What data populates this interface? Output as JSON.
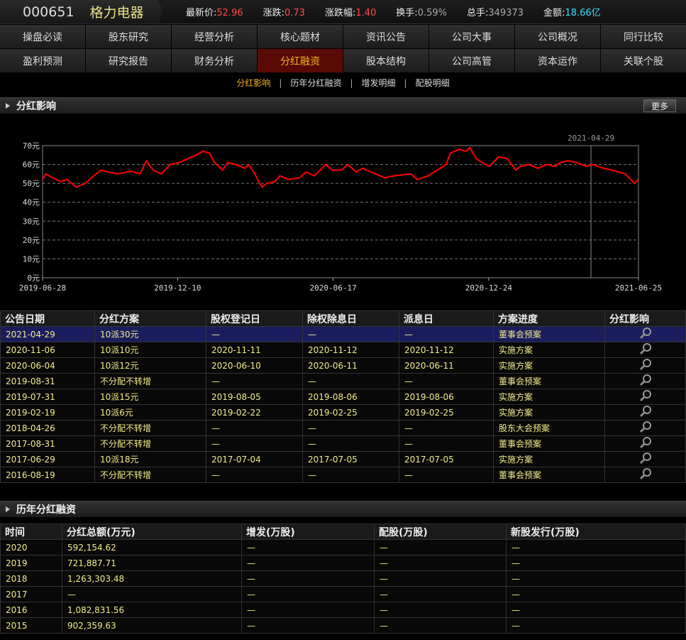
{
  "header": {
    "code": "000651",
    "name": "格力电器",
    "quote": [
      {
        "label": "最新价:",
        "value": "52.96",
        "color": "#ff4d4d"
      },
      {
        "label": "涨跌:",
        "value": "0.73",
        "color": "#ff4d4d"
      },
      {
        "label": "涨跌幅:",
        "value": "1.40",
        "color": "#ff4d4d"
      },
      {
        "label": "换手:",
        "value": "0.59%",
        "color": "#aaaaaa"
      },
      {
        "label": "总手:",
        "value": "349373",
        "color": "#aaaaaa"
      },
      {
        "label": "金额:",
        "value": "18.66亿",
        "color": "#33e0ff"
      }
    ]
  },
  "nav": {
    "row1": [
      "操盘必读",
      "股东研究",
      "经营分析",
      "核心题材",
      "资讯公告",
      "公司大事",
      "公司概况",
      "同行比较"
    ],
    "row2": [
      "盈利预测",
      "研究报告",
      "财务分析",
      "分红融资",
      "股本结构",
      "公司高管",
      "资本运作",
      "关联个股"
    ],
    "active": "分红融资"
  },
  "subnav": {
    "items": [
      "分红影响",
      "历年分红融资",
      "增发明细",
      "配股明细"
    ],
    "active": 0,
    "sep": "|"
  },
  "section1": {
    "title": "分红影响",
    "more": "更多"
  },
  "chart_data": {
    "type": "line",
    "ylim": [
      0,
      70
    ],
    "y_ticks": [
      "0元",
      "10元",
      "20元",
      "30元",
      "40元",
      "50元",
      "60元",
      "70元"
    ],
    "x_ticks": [
      {
        "day": 0,
        "label": "2019-06-28"
      },
      {
        "day": 165,
        "label": "2019-12-10"
      },
      {
        "day": 355,
        "label": "2020-06-17"
      },
      {
        "day": 545,
        "label": "2020-12-24"
      },
      {
        "day": 728,
        "label": "2021-06-25"
      }
    ],
    "marker": {
      "day": 670,
      "label": "2021-04-29"
    },
    "x_span_days": 728,
    "grid": true,
    "series": [
      {
        "name": "price",
        "color": "#ff0000",
        "points": [
          [
            0,
            52
          ],
          [
            4,
            55
          ],
          [
            12,
            53
          ],
          [
            22,
            51
          ],
          [
            30,
            52
          ],
          [
            41,
            48
          ],
          [
            52,
            50
          ],
          [
            60,
            53
          ],
          [
            71,
            57
          ],
          [
            81,
            56
          ],
          [
            92,
            55
          ],
          [
            108,
            56.5
          ],
          [
            119,
            55
          ],
          [
            127,
            62
          ],
          [
            135,
            57
          ],
          [
            145,
            55
          ],
          [
            156,
            60
          ],
          [
            167,
            61
          ],
          [
            177,
            63
          ],
          [
            188,
            65
          ],
          [
            196,
            67
          ],
          [
            204,
            66
          ],
          [
            210,
            61
          ],
          [
            220,
            57
          ],
          [
            226,
            61
          ],
          [
            236,
            60
          ],
          [
            247,
            58
          ],
          [
            252,
            60
          ],
          [
            258,
            56
          ],
          [
            268,
            48
          ],
          [
            274,
            50
          ],
          [
            284,
            51
          ],
          [
            290,
            54
          ],
          [
            300,
            52
          ],
          [
            314,
            53
          ],
          [
            322,
            56
          ],
          [
            332,
            54
          ],
          [
            346,
            60
          ],
          [
            354,
            57
          ],
          [
            365,
            57
          ],
          [
            373,
            60
          ],
          [
            383,
            56
          ],
          [
            391,
            58
          ],
          [
            407,
            55
          ],
          [
            418,
            53
          ],
          [
            429,
            54
          ],
          [
            450,
            55
          ],
          [
            458,
            52
          ],
          [
            471,
            54
          ],
          [
            482,
            57
          ],
          [
            493,
            60
          ],
          [
            498,
            66
          ],
          [
            509,
            68
          ],
          [
            517,
            67
          ],
          [
            522,
            69
          ],
          [
            530,
            63
          ],
          [
            541,
            60
          ],
          [
            546,
            59
          ],
          [
            557,
            64
          ],
          [
            568,
            63
          ],
          [
            578,
            57
          ],
          [
            584,
            59
          ],
          [
            594,
            60
          ],
          [
            605,
            58
          ],
          [
            616,
            60
          ],
          [
            626,
            59
          ],
          [
            632,
            61
          ],
          [
            642,
            62
          ],
          [
            653,
            61
          ],
          [
            664,
            59
          ],
          [
            672,
            60
          ],
          [
            685,
            58
          ],
          [
            696,
            57
          ],
          [
            712,
            55
          ],
          [
            723,
            50
          ],
          [
            728,
            52
          ]
        ]
      }
    ]
  },
  "table1": {
    "headers": [
      "公告日期",
      "分红方案",
      "股权登记日",
      "除权除息日",
      "派息日",
      "方案进度",
      "分红影响"
    ],
    "rows": [
      [
        "2021-04-29",
        "10派30元",
        "—",
        "—",
        "—",
        "董事会预案"
      ],
      [
        "2020-11-06",
        "10派10元",
        "2020-11-11",
        "2020-11-12",
        "2020-11-12",
        "实施方案"
      ],
      [
        "2020-06-04",
        "10派12元",
        "2020-06-10",
        "2020-06-11",
        "2020-06-11",
        "实施方案"
      ],
      [
        "2019-08-31",
        "不分配不转增",
        "—",
        "—",
        "—",
        "董事会预案"
      ],
      [
        "2019-07-31",
        "10派15元",
        "2019-08-05",
        "2019-08-06",
        "2019-08-06",
        "实施方案"
      ],
      [
        "2019-02-19",
        "10派6元",
        "2019-02-22",
        "2019-02-25",
        "2019-02-25",
        "实施方案"
      ],
      [
        "2018-04-26",
        "不分配不转增",
        "—",
        "—",
        "—",
        "股东大会预案"
      ],
      [
        "2017-08-31",
        "不分配不转增",
        "—",
        "—",
        "—",
        "董事会预案"
      ],
      [
        "2017-06-29",
        "10派18元",
        "2017-07-04",
        "2017-07-05",
        "2017-07-05",
        "实施方案"
      ],
      [
        "2016-08-19",
        "不分配不转增",
        "—",
        "—",
        "—",
        "董事会预案"
      ]
    ]
  },
  "section2": {
    "title": "历年分红融资"
  },
  "table2": {
    "headers": [
      "时间",
      "分红总额(万元)",
      "增发(万股)",
      "配股(万股)",
      "新股发行(万股)"
    ],
    "rows": [
      [
        "2020",
        "592,154.62",
        "—",
        "—",
        "—"
      ],
      [
        "2019",
        "721,887.71",
        "—",
        "—",
        "—"
      ],
      [
        "2018",
        "1,263,303.48",
        "—",
        "—",
        "—"
      ],
      [
        "2017",
        "—",
        "—",
        "—",
        "—"
      ],
      [
        "2016",
        "1,082,831.56",
        "—",
        "—",
        "—"
      ],
      [
        "2015",
        "902,359.63",
        "—",
        "—",
        "—"
      ]
    ]
  }
}
